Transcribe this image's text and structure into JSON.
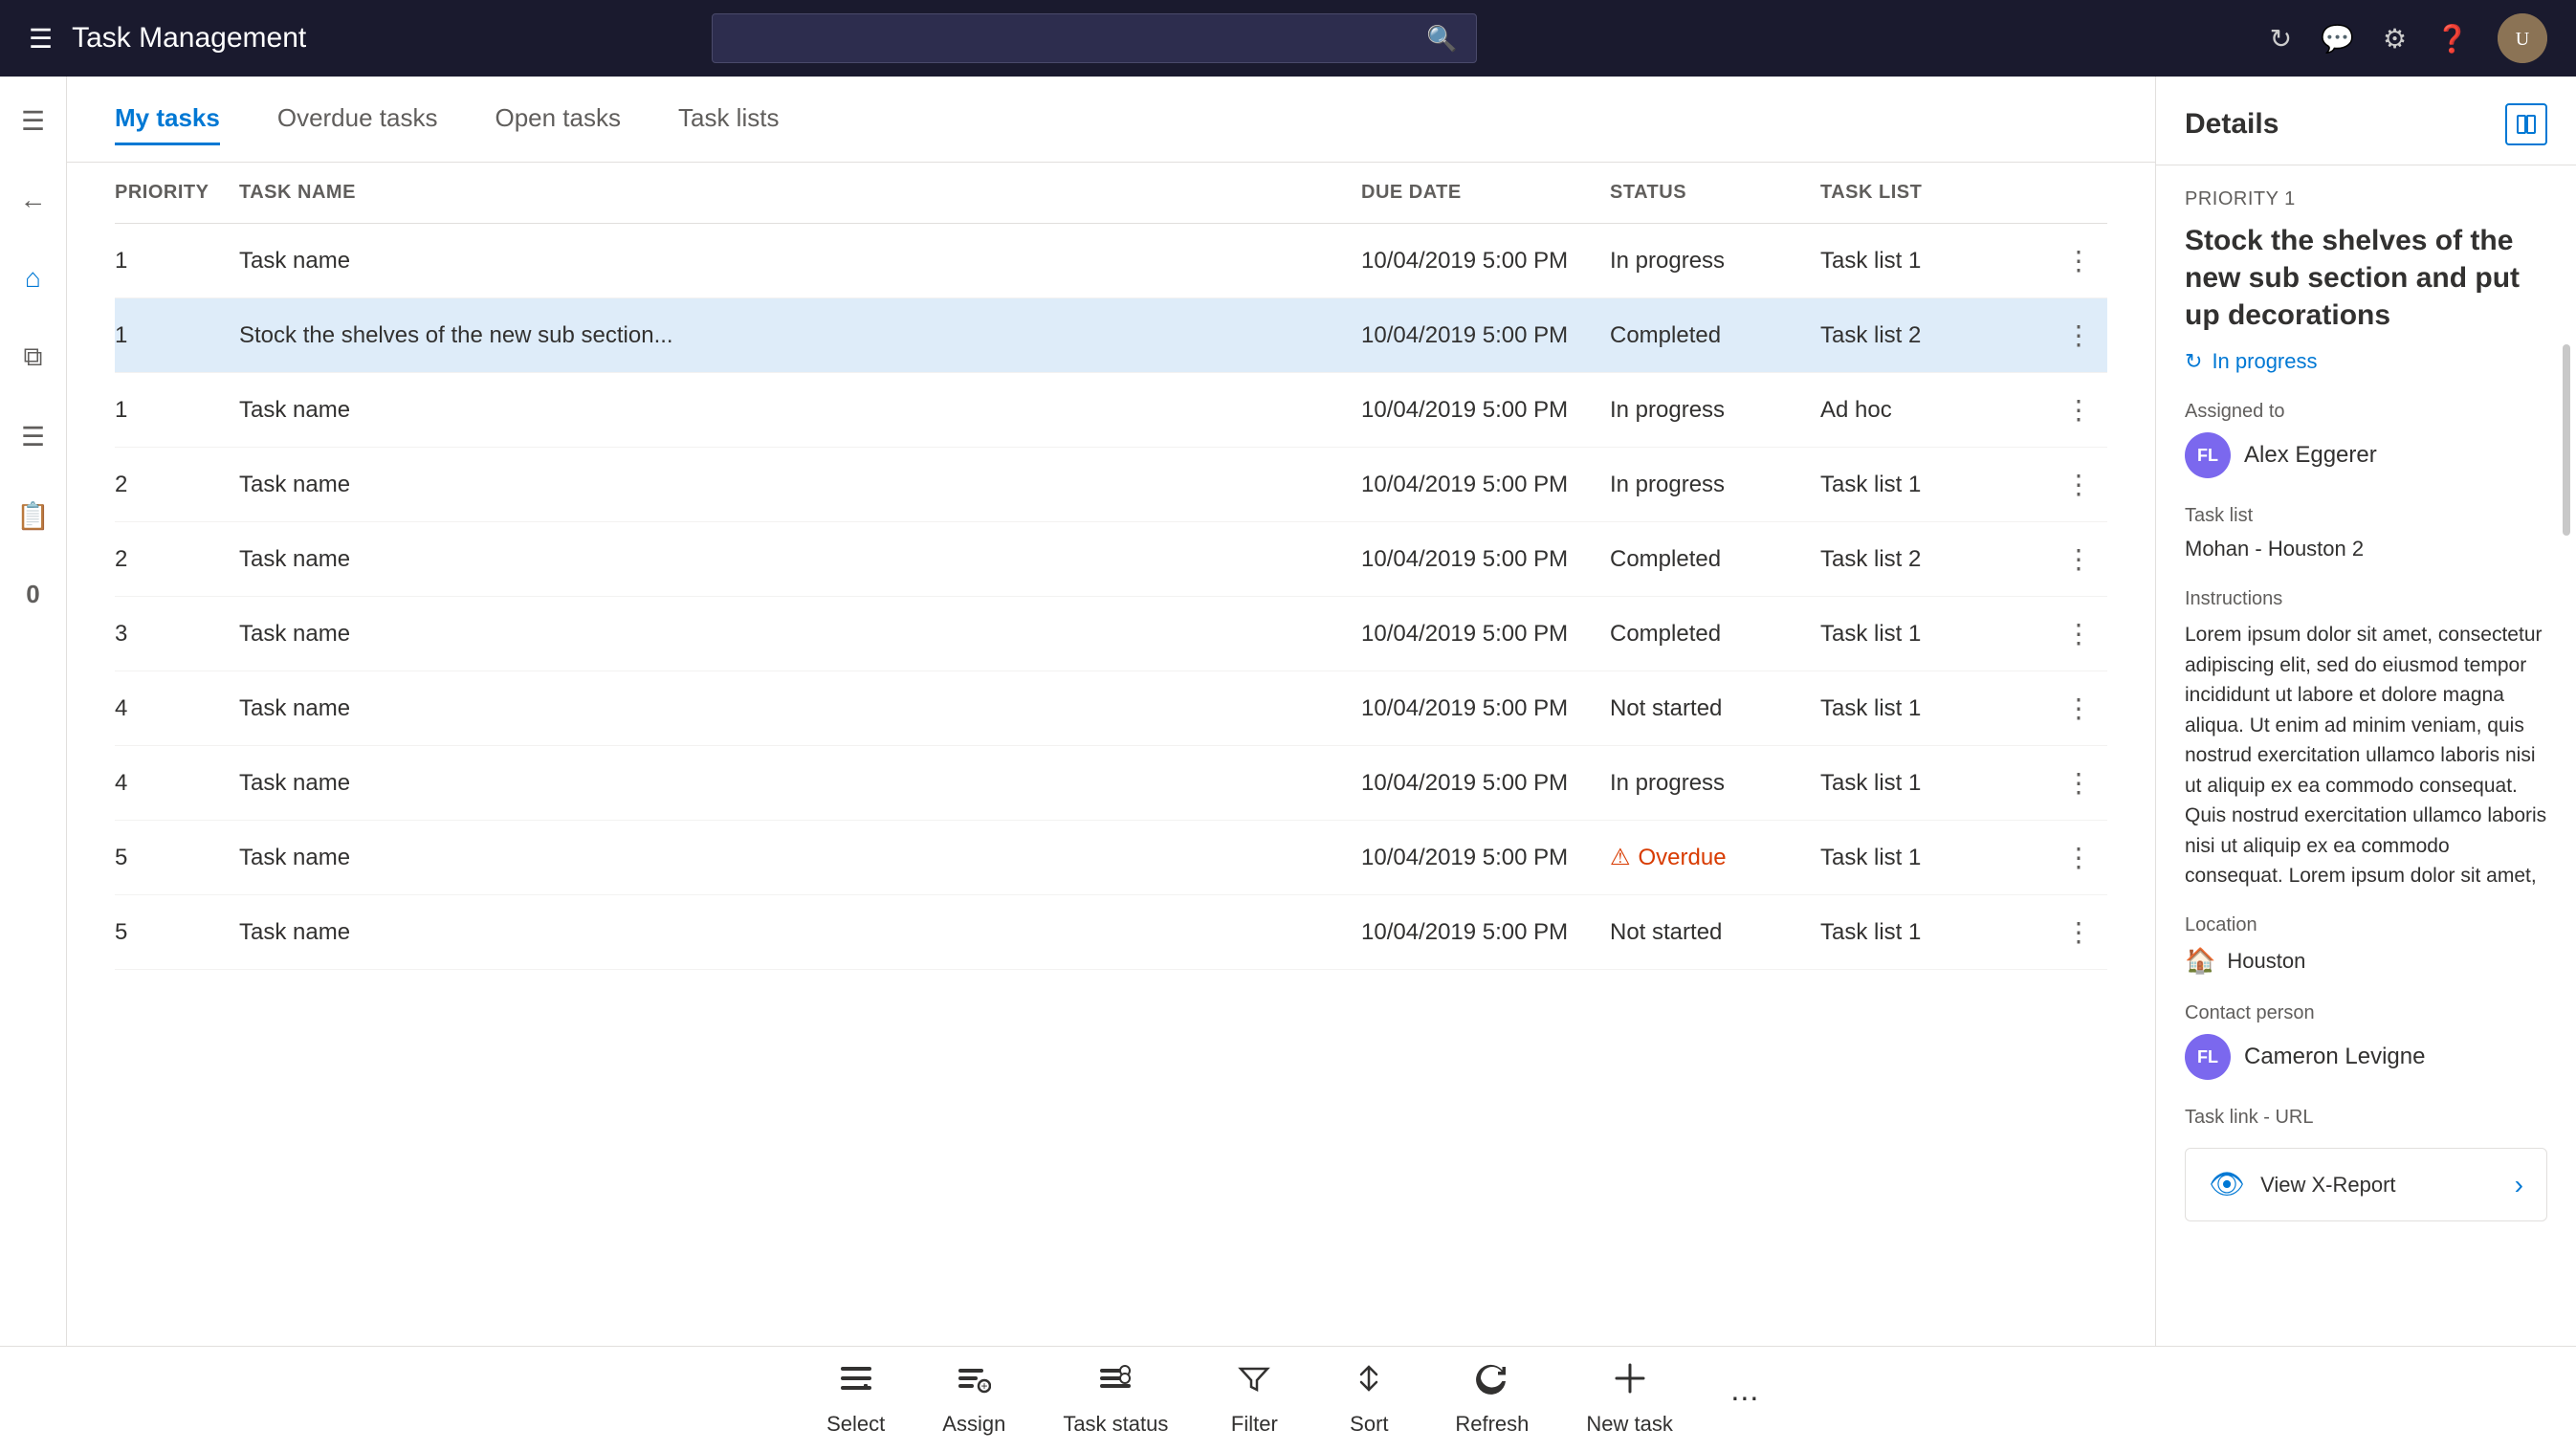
{
  "app": {
    "title": "Task Management",
    "search_placeholder": ""
  },
  "topbar": {
    "icons": [
      "refresh",
      "chat",
      "settings",
      "help"
    ],
    "avatar_initials": "U"
  },
  "sidebar": {
    "icons": [
      "menu",
      "home",
      "apps",
      "list",
      "clipboard",
      "zero"
    ]
  },
  "tabs": [
    {
      "label": "My tasks",
      "active": true
    },
    {
      "label": "Overdue tasks",
      "active": false
    },
    {
      "label": "Open tasks",
      "active": false
    },
    {
      "label": "Task lists",
      "active": false
    }
  ],
  "table": {
    "headers": {
      "priority": "Priority",
      "task_name": "Task Name",
      "due_date": "Due Date",
      "status": "Status",
      "task_list": "Task List"
    },
    "rows": [
      {
        "priority": "1",
        "task_name": "Task name",
        "due_date": "10/04/2019 5:00 PM",
        "status": "In progress",
        "task_list": "Task list 1",
        "selected": false
      },
      {
        "priority": "1",
        "task_name": "Stock the shelves of the new sub section...",
        "due_date": "10/04/2019 5:00 PM",
        "status": "Completed",
        "task_list": "Task list 2",
        "selected": true
      },
      {
        "priority": "1",
        "task_name": "Task name",
        "due_date": "10/04/2019 5:00 PM",
        "status": "In progress",
        "task_list": "Ad hoc",
        "selected": false
      },
      {
        "priority": "2",
        "task_name": "Task name",
        "due_date": "10/04/2019 5:00 PM",
        "status": "In progress",
        "task_list": "Task list 1",
        "selected": false
      },
      {
        "priority": "2",
        "task_name": "Task name",
        "due_date": "10/04/2019 5:00 PM",
        "status": "Completed",
        "task_list": "Task list 2",
        "selected": false
      },
      {
        "priority": "3",
        "task_name": "Task name",
        "due_date": "10/04/2019 5:00 PM",
        "status": "Completed",
        "task_list": "Task list 1",
        "selected": false
      },
      {
        "priority": "4",
        "task_name": "Task name",
        "due_date": "10/04/2019 5:00 PM",
        "status": "Not started",
        "task_list": "Task list 1",
        "selected": false
      },
      {
        "priority": "4",
        "task_name": "Task name",
        "due_date": "10/04/2019 5:00 PM",
        "status": "In progress",
        "task_list": "Task list 1",
        "selected": false
      },
      {
        "priority": "5",
        "task_name": "Task name",
        "due_date": "10/04/2019 5:00 PM",
        "status": "Overdue",
        "task_list": "Task list 1",
        "selected": false
      },
      {
        "priority": "5",
        "task_name": "Task name",
        "due_date": "10/04/2019 5:00 PM",
        "status": "Not started",
        "task_list": "Task list 1",
        "selected": false
      }
    ]
  },
  "details": {
    "title": "Details",
    "priority_label": "Priority 1",
    "task_title": "Stock the shelves of the new sub section and put up decorations",
    "status": "In progress",
    "assigned_to_label": "Assigned to",
    "assignee_initials": "FL",
    "assignee_name": "Alex Eggerer",
    "task_list_label": "Task list",
    "task_list_value": "Mohan - Houston 2",
    "instructions_label": "Instructions",
    "instructions_text": "Lorem ipsum dolor sit amet, consectetur adipiscing elit, sed do eiusmod tempor incididunt ut labore et dolore magna aliqua. Ut enim ad minim veniam, quis nostrud exercitation ullamco laboris nisi ut aliquip ex ea commodo consequat. Quis nostrud exercitation ullamco laboris nisi ut aliquip ex ea commodo consequat. Lorem ipsum dolor sit amet, consectetur Quis nostrud exercitation ullamco laboris nisi ut",
    "location_label": "Location",
    "location_value": "Houston",
    "contact_label": "Contact person",
    "contact_initials": "FL",
    "contact_name": "Cameron Levigne",
    "url_label": "Task link - URL",
    "view_report_label": "View X-Report"
  },
  "toolbar": {
    "items": [
      {
        "id": "select",
        "label": "Select",
        "icon": "select"
      },
      {
        "id": "assign",
        "label": "Assign",
        "icon": "assign"
      },
      {
        "id": "task_status",
        "label": "Task status",
        "icon": "task-status"
      },
      {
        "id": "filter",
        "label": "Filter",
        "icon": "filter"
      },
      {
        "id": "sort",
        "label": "Sort",
        "icon": "sort"
      },
      {
        "id": "refresh",
        "label": "Refresh",
        "icon": "refresh"
      },
      {
        "id": "new_task",
        "label": "New task",
        "icon": "new-task"
      }
    ]
  }
}
